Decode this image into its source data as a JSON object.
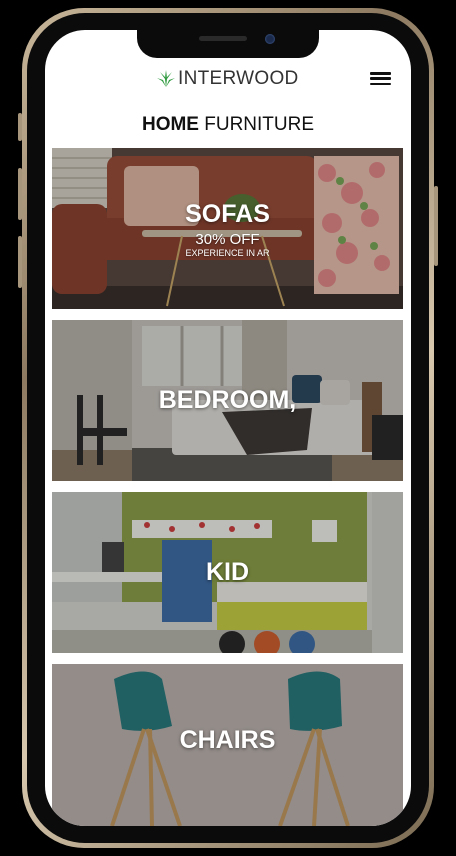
{
  "brand": {
    "name": "INTERWOOD",
    "logo_color": "#2e9a3e"
  },
  "page_title": {
    "bold": "HOME",
    "rest": "FURNITURE"
  },
  "categories": [
    {
      "label": "SOFAS",
      "discount": "30% OFF",
      "note": "EXPERIENCE IN AR"
    },
    {
      "label": "BEDROOM,"
    },
    {
      "label": "KID"
    },
    {
      "label": "CHAIRS"
    }
  ]
}
